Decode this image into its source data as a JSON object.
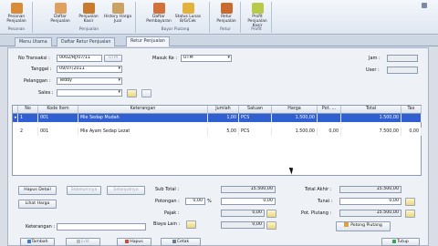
{
  "ribbon": {
    "buttons": [
      {
        "label": "Pesanan Penjualan",
        "color": "#d98b3a"
      },
      {
        "label": "Daftar Penjualan",
        "color": "#e0a060"
      },
      {
        "label": "Penjualan Kasir",
        "color": "#c97a2c"
      },
      {
        "label": "History Harga Jual",
        "color": "#caa264"
      },
      {
        "label": "Daftar Pembayaran",
        "color": "#d2713a"
      },
      {
        "label": "Status Lunas B/G/Cek",
        "color": "#e3b23c"
      },
      {
        "label": "Retur Penjualan",
        "color": "#c96a2f"
      },
      {
        "label": "Profit Penjualan Kasir",
        "color": "#b9c94a"
      }
    ],
    "groups": [
      "Pesanan",
      "Penjualan",
      "Bayar Piutang",
      "Retur",
      "Profit"
    ]
  },
  "tabs": [
    "Menu Utama",
    "Daftar Retur Penjualan",
    "Retur Penjualan"
  ],
  "form": {
    "no_transaksi_label": "No Transaksi :",
    "no_transaksi": "0002/RJ/07/11",
    "no_transaksi_btn": "UTM",
    "tanggal_label": "Tanggal :",
    "tanggal": "09/07/2011",
    "pelanggan_label": "Pelanggan :",
    "pelanggan": "Teddy",
    "sales_label": "Sales :",
    "sales": "",
    "masuk_ke_label": "Masuk Ke :",
    "masuk_ke": "UTM",
    "jam_label": "Jam :",
    "jam": "",
    "user_label": "User :",
    "user": ""
  },
  "grid": {
    "columns": [
      "No",
      "Kode Item",
      "Keterangan",
      "Jumlah",
      "Satuan",
      "Harga",
      "Pot. ...",
      "Total",
      "Tax"
    ],
    "rows": [
      {
        "no": "1",
        "kode": "001",
        "keterangan": "Mie Sedap Mudah",
        "jumlah": "1,00",
        "satuan": "PCS",
        "harga": "1.500,00",
        "pot": "",
        "total": "1.500,00",
        "tax": ""
      },
      {
        "no": "2",
        "kode": "001",
        "keterangan": "Mie Ayam Sedap Lezat",
        "jumlah": "5,00",
        "satuan": "PCS",
        "harga": "1.500,00",
        "pot": "0,00",
        "total": "7.500,00",
        "tax": "0,00"
      }
    ]
  },
  "actions": {
    "hapus_detail": "Hapus Detail",
    "sebelumnya": "Sebelumnya",
    "selanjutnya": "Selanjutnya",
    "lihat_harga": "Lihat Harga",
    "keterangan_label": "Keterangan :",
    "keterangan": ""
  },
  "totals": {
    "sub_total_label": "Sub Total :",
    "sub_total": "15.500,00",
    "potongan_label": "Potongan :",
    "potongan_pct": "0,00",
    "potongan": "0,00",
    "pajak_label": "Pajak :",
    "pajak": "0,00",
    "biaya_lain_label": "Biaya Lain :",
    "biaya_lain": "0,00",
    "total_akhir_label": "Total Akhir :",
    "total_akhir": "15.500,00",
    "tunai_label": "Tunai :",
    "tunai": "0,00",
    "pot_piutang_label": "Pot. Piutang :",
    "pot_piutang": "15.500,00",
    "potong_piutang_btn": "Potong Piutang"
  },
  "footer": {
    "tambah": "Tambah",
    "edit": "Edit",
    "hapus": "Hapus",
    "cetak": "Cetak",
    "tutup": "Tutup"
  }
}
